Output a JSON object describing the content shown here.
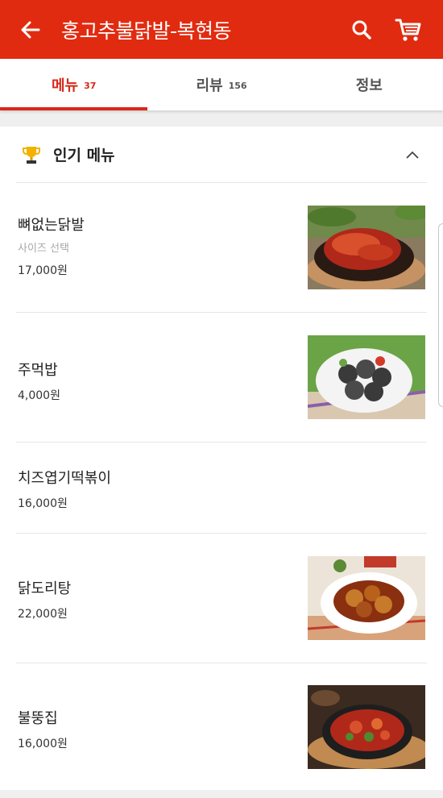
{
  "appbar": {
    "title": "홍고추불닭발-복현동",
    "back_icon": "arrow-left-icon",
    "search_icon": "search-icon",
    "cart_icon": "cart-icon",
    "background_color": "#e12b10"
  },
  "tabs": [
    {
      "label": "메뉴",
      "count": "37",
      "active": true
    },
    {
      "label": "리뷰",
      "count": "156",
      "active": false
    },
    {
      "label": "정보",
      "count": "",
      "active": false
    }
  ],
  "section": {
    "title": "인기 메뉴",
    "icon": "trophy-icon",
    "collapse_icon": "chevron-up-icon"
  },
  "menu_items": [
    {
      "name": "뼈없는닭발",
      "option": "사이즈 선택",
      "price": "17,000원"
    },
    {
      "name": "주먹밥",
      "price": "4,000원"
    },
    {
      "name": "치즈엽기떡볶이",
      "price": "16,000원"
    },
    {
      "name": "닭도리탕",
      "price": "22,000원"
    },
    {
      "name": "불뚱집",
      "price": "16,000원"
    }
  ],
  "accent_color": "#d8281a"
}
